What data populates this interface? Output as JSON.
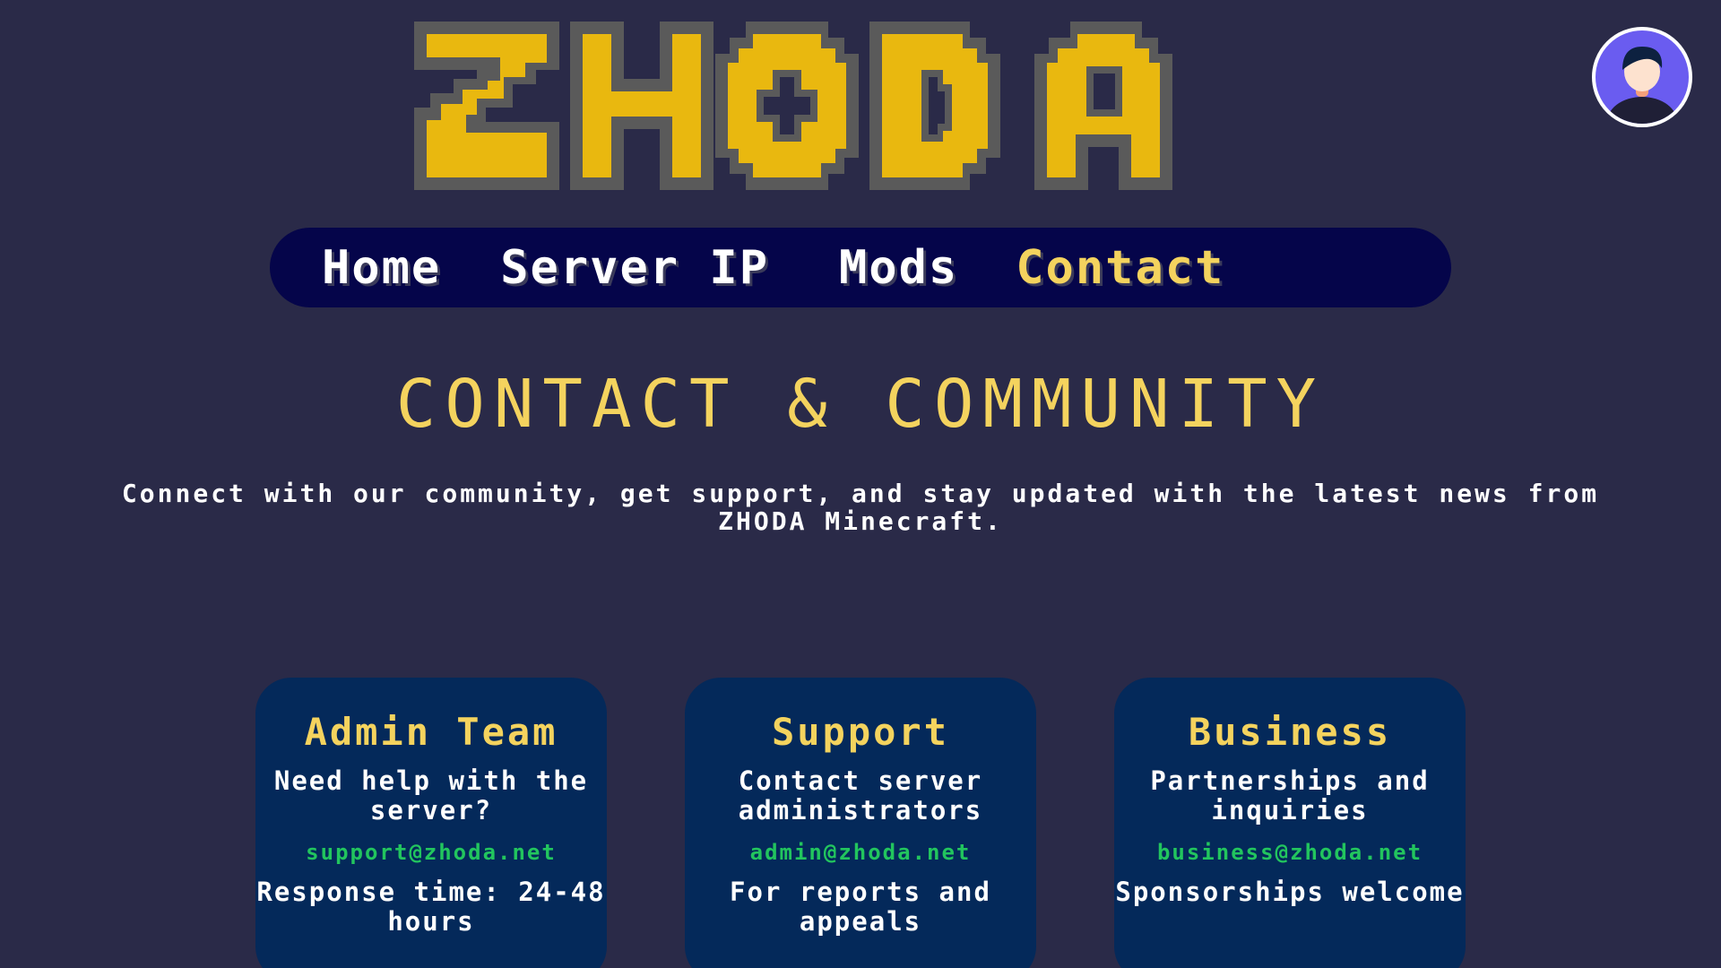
{
  "brand": {
    "logo_text": "ZHODA",
    "logo_color": "#e9b80f",
    "logo_outline_color": "#5a5a5a"
  },
  "user": {
    "avatar_icon": "user-avatar-icon"
  },
  "nav": {
    "items": [
      {
        "label": "Home",
        "active": false
      },
      {
        "label": "Server IP",
        "active": false
      },
      {
        "label": "Mods",
        "active": false
      },
      {
        "label": "Contact",
        "active": true
      }
    ]
  },
  "main": {
    "title": "CONTACT & COMMUNITY",
    "intro": "Connect with our community, get support, and stay updated with the latest news from ZHODA Minecraft."
  },
  "cards": [
    {
      "title": "Admin Team",
      "description": "Need help with the server?",
      "email": "support@zhoda.net",
      "note": "Response time: 24-48 hours"
    },
    {
      "title": "Support",
      "description": "Contact server administrators",
      "email": "admin@zhoda.net",
      "note": "For reports and appeals"
    },
    {
      "title": "Business",
      "description": "Partnerships and inquiries",
      "email": "business@zhoda.net",
      "note": "Sponsorships welcome"
    }
  ],
  "colors": {
    "background": "#2a2a48",
    "nav_background": "#05054a",
    "card_background": "#04295a",
    "accent_yellow": "#f4d35e",
    "email_green": "#22c55e",
    "avatar_background": "#6a5cf0"
  }
}
